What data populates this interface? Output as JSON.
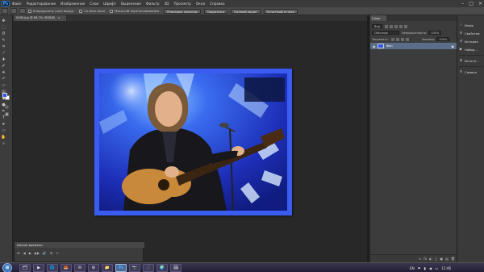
{
  "app": {
    "logo": "Ps",
    "menu": [
      "Файл",
      "Редактирование",
      "Изображение",
      "Слои",
      "Шрифт",
      "Выделение",
      "Фильтр",
      "3D",
      "Просмотр",
      "Окно",
      "Справка"
    ]
  },
  "window_controls": {
    "minimize": "–",
    "maximize": "□",
    "close": "×"
  },
  "options_bar": {
    "checks": [
      "Упорядочить поле вокруг",
      "Со всех окон",
      "Масштаб перетаскиванием"
    ],
    "buttons": [
      "Реальные пикселы",
      "Подогнать",
      "Полный экран",
      "Печатный оттиск"
    ]
  },
  "document": {
    "tab_title": "0060.jpg @ 66,7% (RGB/8)",
    "close": "×"
  },
  "layers_panel": {
    "tab": "Слои",
    "filter_kind": "Вид",
    "blend_mode": "Обычные",
    "opacity_label": "Непрозрачность:",
    "opacity_value": "100%",
    "lock_label": "Закрепить:",
    "fill_label": "Заливка:",
    "fill_value": "100%",
    "layer_name": "Фон",
    "eye": "◉",
    "lock": "🔒",
    "footer_icons": [
      "∞",
      "fx",
      "◐",
      "▢",
      "▣",
      "▤",
      "🗑"
    ]
  },
  "side_panel": {
    "items": [
      {
        "label": "Инфо",
        "icon": "info-icon",
        "glyph": "i"
      },
      {
        "label": "Свойства",
        "icon": "properties-icon",
        "glyph": "≡"
      },
      {
        "label": "История",
        "icon": "history-icon",
        "glyph": "↺"
      },
      {
        "label": "Набор...",
        "icon": "actions-icon",
        "glyph": "▶"
      },
      {
        "label": "Источн...",
        "icon": "clone-source-icon",
        "glyph": "⊕"
      },
      {
        "label": "Символ",
        "icon": "character-icon",
        "glyph": "A"
      }
    ]
  },
  "timeline": {
    "title": "Шкала времени",
    "controls": [
      "⏮",
      "◀",
      "▶",
      "▶▶",
      "🔊",
      "⚙",
      "✂"
    ]
  },
  "taskbar": {
    "start": "⊞",
    "apps": [
      "🗂",
      "▶",
      "🌐",
      "🦊",
      "✉",
      "⚙",
      "📁",
      "Ps",
      "📷",
      "🎵",
      "🌍",
      "🖼"
    ],
    "tray": {
      "lang": "EN",
      "clock": "11:46"
    }
  },
  "colors": {
    "foreground": "#2f55e8",
    "background": "#ffffff",
    "accent": "#3a5cf0"
  },
  "photo": {
    "description_hidden": ""
  }
}
